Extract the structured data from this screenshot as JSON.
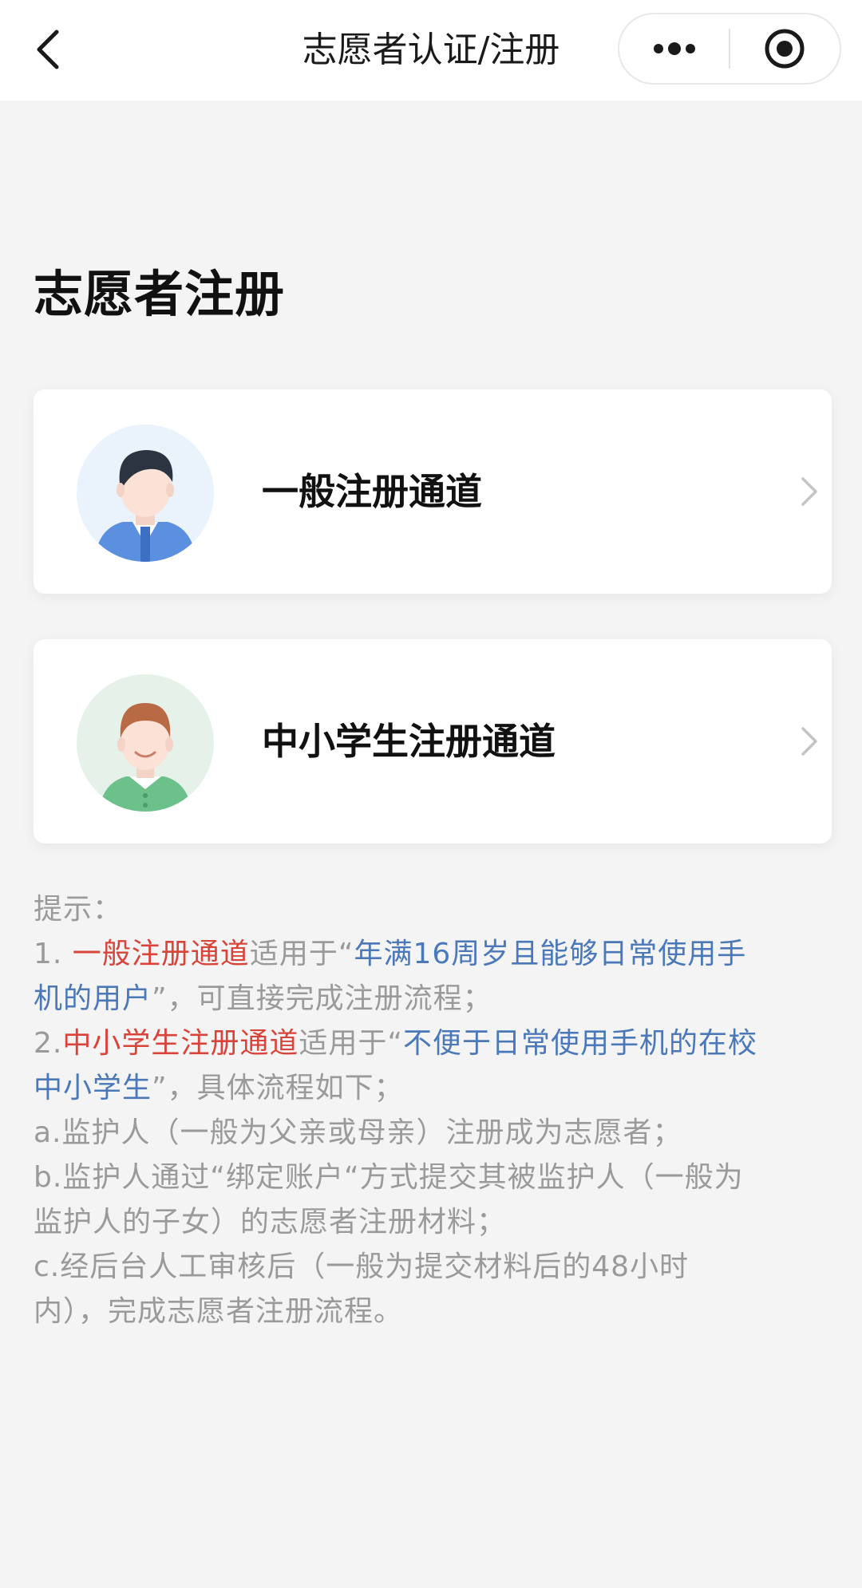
{
  "nav": {
    "title": "志愿者认证/注册",
    "back_icon": "chevron-left-icon",
    "more_icon": "more-dots-icon",
    "close_icon": "target-circle-icon"
  },
  "page": {
    "title": "志愿者注册"
  },
  "channels": [
    {
      "label": "一般注册通道",
      "avatar": "adult-avatar-icon",
      "avatar_bg": "#eaf3fb"
    },
    {
      "label": "中小学生注册通道",
      "avatar": "student-avatar-icon",
      "avatar_bg": "#e6f2e9"
    }
  ],
  "tips": {
    "heading": "提示：",
    "line1_prefix": "1. ",
    "line1_red": "一般注册通道",
    "line1_mid": "适用于“",
    "line1_blue_a": "年满16周岁且能够日常使用手",
    "line2_blue_b": "机的用户",
    "line2_rest": "”，可直接完成注册流程；",
    "line3_prefix": "2.",
    "line3_red": "中小学生注册通道",
    "line3_mid": "适用于“",
    "line3_blue_a": "不便于日常使用手机的在校",
    "line4_blue_b": "中小学生",
    "line4_rest": "”，具体流程如下；",
    "line5": "a.监护人（一般为父亲或母亲）注册成为志愿者；",
    "line6": "b.监护人通过“绑定账户“方式提交其被监护人（一般为",
    "line7": "监护人的子女）的志愿者注册材料；",
    "line8": "c.经后台人工审核后（一般为提交材料后的48小时",
    "line9": "内），完成志愿者注册流程。"
  },
  "colors": {
    "highlight_red": "#d9443a",
    "highlight_blue": "#4a78b8",
    "tip_gray": "#9a9a9a",
    "background": "#f4f4f4"
  }
}
